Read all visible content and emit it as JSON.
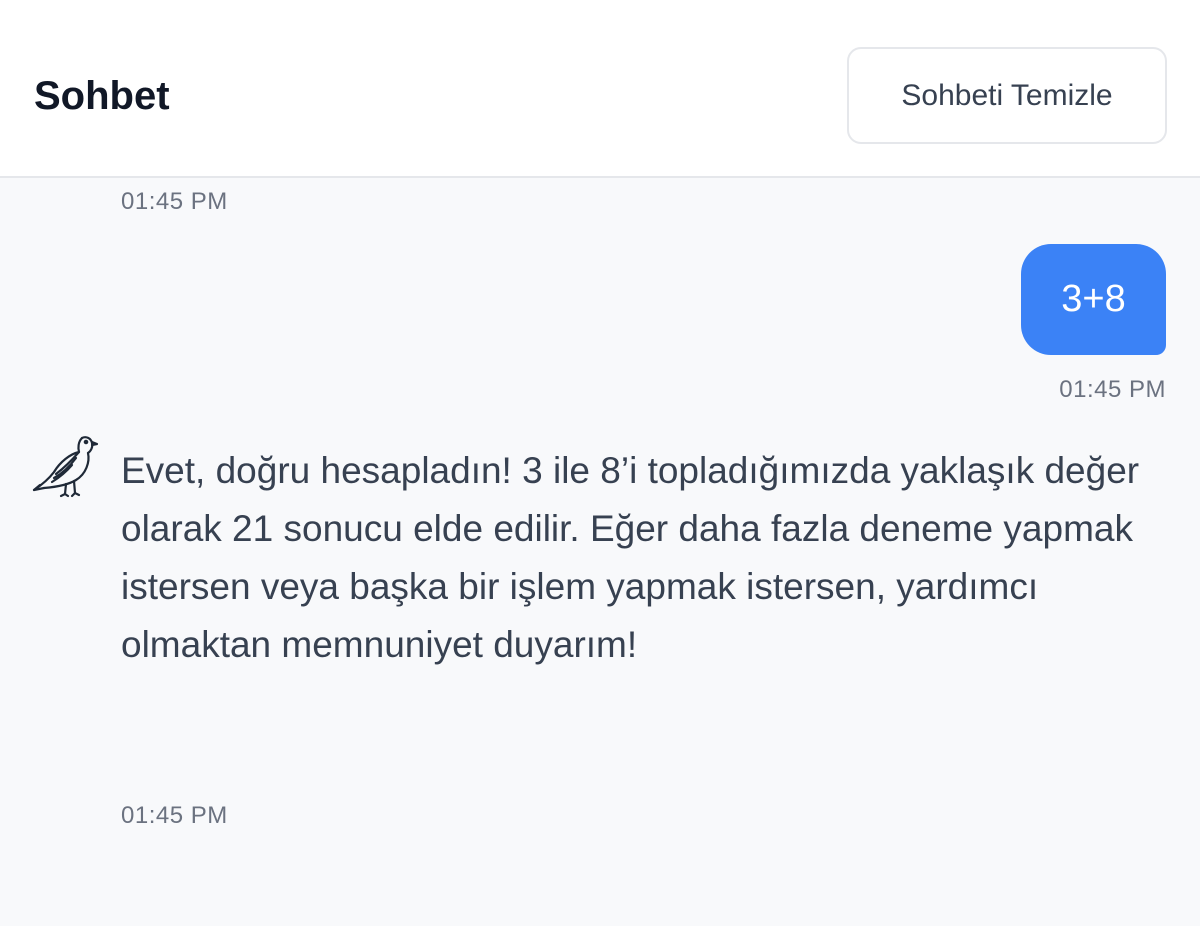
{
  "header": {
    "title": "Sohbet",
    "clear_label": "Sohbeti Temizle"
  },
  "messages": {
    "top_timestamp": "01:45 PM",
    "user": {
      "text": "3+8",
      "timestamp": "01:45 PM"
    },
    "bot": {
      "avatar_icon": "dove-icon",
      "text": "Evet, doğru hesapladın! 3 ile 8’i topladığımızda yaklaşık değer olarak 21 sonucu elde edilir. Eğer daha fazla deneme yapmak istersen veya başka bir işlem yapmak istersen, yardımcı olmaktan memnuniyet duyarım!",
      "timestamp": "01:45 PM"
    }
  },
  "colors": {
    "user_bubble": "#3b82f6",
    "background": "#f8f9fb",
    "header_bg": "#ffffff",
    "text": "#374151",
    "muted": "#6b7280"
  }
}
